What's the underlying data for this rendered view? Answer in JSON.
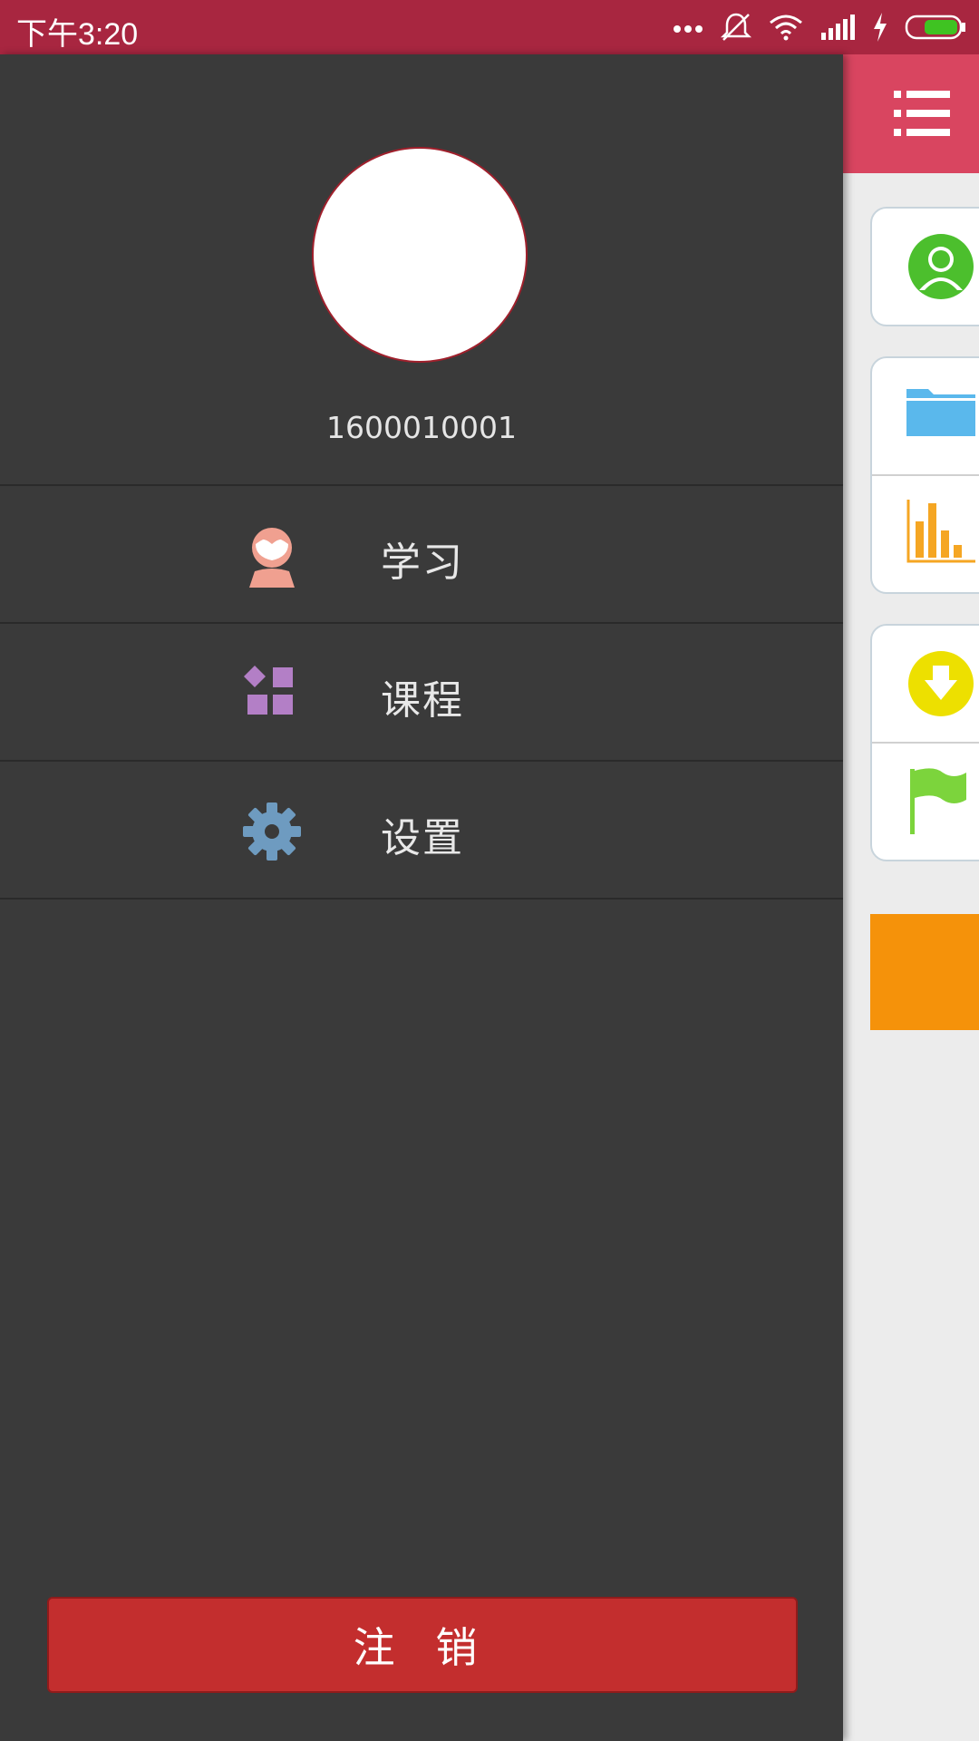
{
  "status_bar": {
    "time": "下午3:20",
    "icons": [
      "more-dots-icon",
      "mute-icon",
      "wifi-icon",
      "signal-icon",
      "charging-icon",
      "battery-icon"
    ],
    "battery_color": "#3fc322"
  },
  "drawer": {
    "username": "1600010001",
    "menu": [
      {
        "label": "学习",
        "icon": "student-icon",
        "color": "#f0a090"
      },
      {
        "label": "课程",
        "icon": "course-grid-icon",
        "color": "#b37fc6"
      },
      {
        "label": "设置",
        "icon": "gear-icon",
        "color": "#6e9bc0"
      }
    ],
    "logout_label": "注 销"
  },
  "main": {
    "header_color": "#d94560",
    "menu_icon": "list-menu-icon",
    "cards": [
      {
        "icons": [
          "user-icon"
        ]
      },
      {
        "icons": [
          "folder-icon",
          "bar-chart-icon"
        ]
      },
      {
        "icons": [
          "download-icon",
          "flag-icon"
        ]
      }
    ],
    "accent_orange": "#f5920a"
  }
}
